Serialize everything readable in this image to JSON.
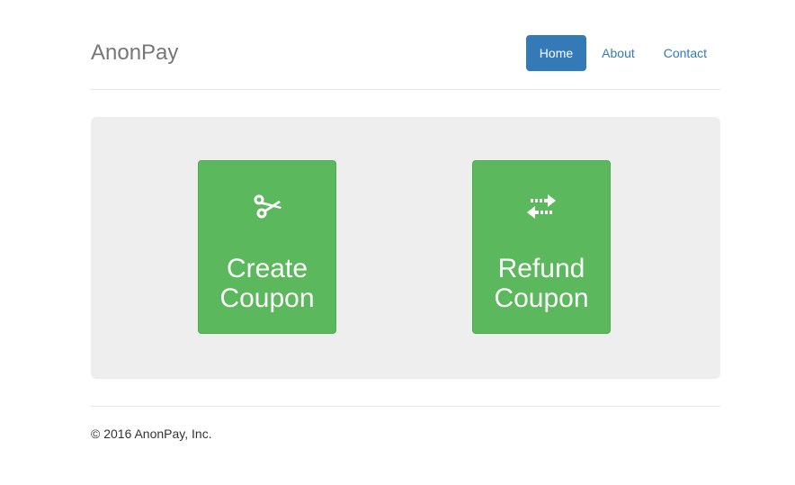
{
  "header": {
    "brand": "AnonPay",
    "nav": [
      {
        "label": "Home",
        "active": true
      },
      {
        "label": "About",
        "active": false
      },
      {
        "label": "Contact",
        "active": false
      }
    ]
  },
  "main": {
    "actions": [
      {
        "label": "Create\nCoupon",
        "icon": "scissors-icon"
      },
      {
        "label": "Refund\nCoupon",
        "icon": "transfer-arrows-icon"
      }
    ]
  },
  "footer": {
    "text": "© 2016 AnonPay, Inc."
  },
  "colors": {
    "primary": "#337ab7",
    "success": "#5cb85c",
    "jumbotron_bg": "#eeeeee",
    "brand_text": "#777777"
  }
}
